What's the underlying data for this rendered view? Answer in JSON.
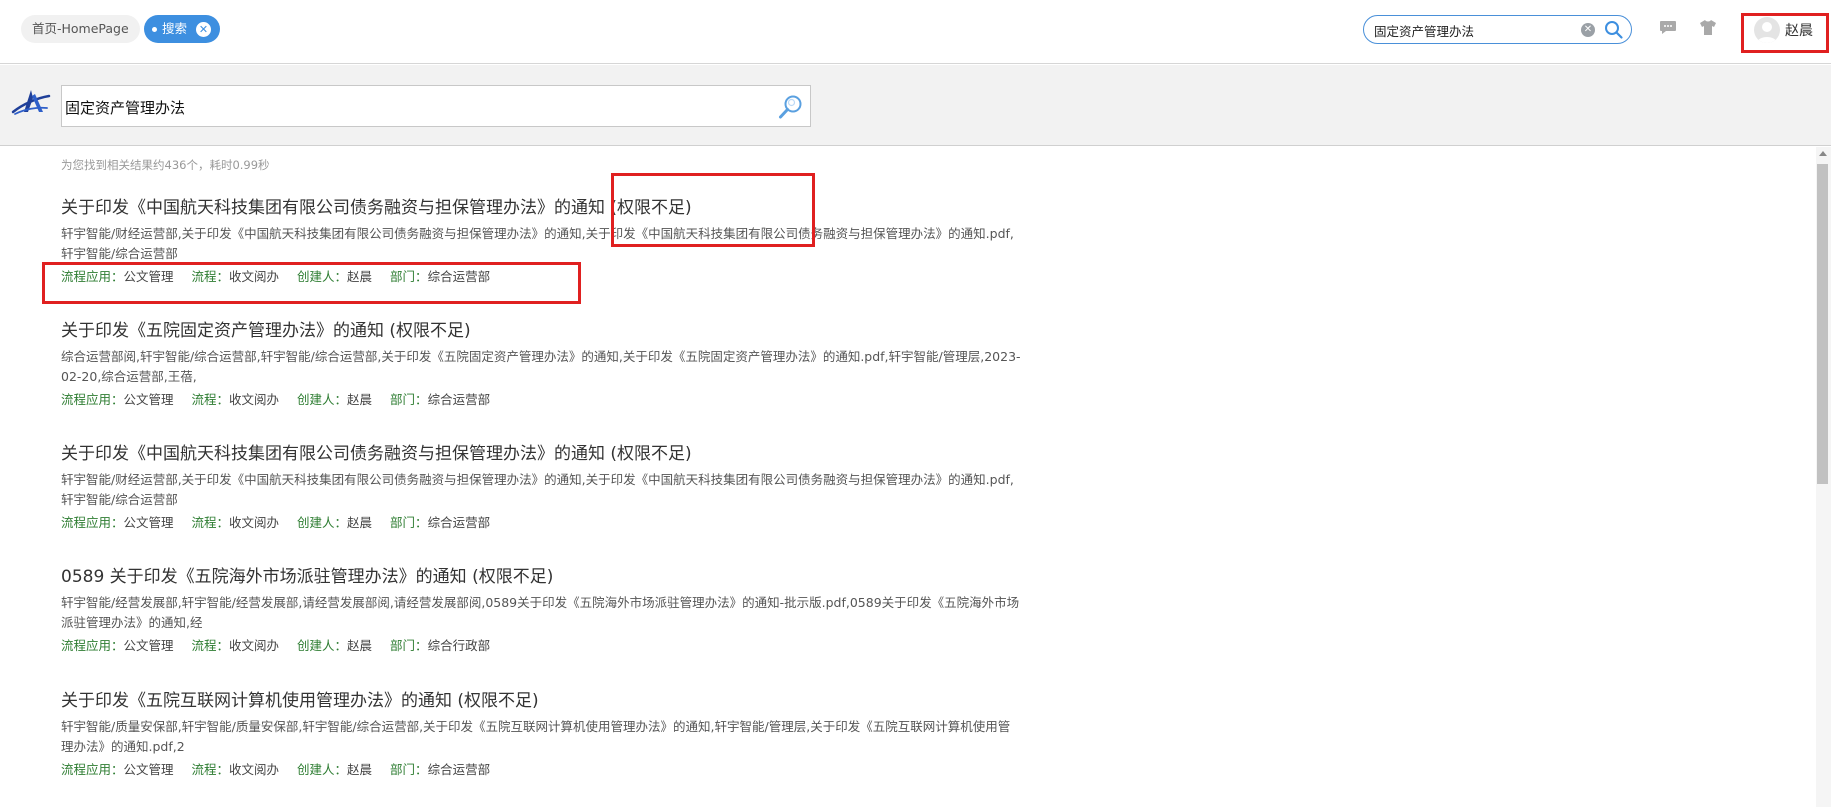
{
  "tabs": {
    "home_label": "首页-HomePage",
    "search_label": "搜索",
    "close_glyph": "✕"
  },
  "top_search": {
    "value": "固定资产管理办法",
    "clear_glyph": "✕"
  },
  "user": {
    "name": "赵晨"
  },
  "main_search": {
    "value": "固定资产管理办法"
  },
  "result_count": "为您找到相关结果约436个，耗时0.99秒",
  "meta_keys": {
    "app": "流程应用：",
    "flow": "流程：",
    "creator": "创建人：",
    "dept": "部门："
  },
  "results": [
    {
      "title": "关于印发《中国航天科技集团有限公司债务融资与担保管理办法》的通知 (权限不足)",
      "desc": "轩宇智能/财经运营部,关于印发《中国航天科技集团有限公司债务融资与担保管理办法》的通知,关于印发《中国航天科技集团有限公司债务融资与担保管理办法》的通知.pdf,轩宇智能/综合运营部",
      "app": "公文管理",
      "flow": "收文阅办",
      "creator": "赵晨",
      "dept": "综合运营部"
    },
    {
      "title": "关于印发《五院固定资产管理办法》的通知 (权限不足)",
      "desc": "综合运营部阅,轩宇智能/综合运营部,轩宇智能/综合运营部,关于印发《五院固定资产管理办法》的通知,关于印发《五院固定资产管理办法》的通知.pdf,轩宇智能/管理层,2023-02-20,综合运营部,王蓓,",
      "app": "公文管理",
      "flow": "收文阅办",
      "creator": "赵晨",
      "dept": "综合运营部"
    },
    {
      "title": "关于印发《中国航天科技集团有限公司债务融资与担保管理办法》的通知 (权限不足)",
      "desc": "轩宇智能/财经运营部,关于印发《中国航天科技集团有限公司债务融资与担保管理办法》的通知,关于印发《中国航天科技集团有限公司债务融资与担保管理办法》的通知.pdf,轩宇智能/综合运营部",
      "app": "公文管理",
      "flow": "收文阅办",
      "creator": "赵晨",
      "dept": "综合运营部"
    },
    {
      "title": "0589 关于印发《五院海外市场派驻管理办法》的通知 (权限不足)",
      "desc": "轩宇智能/经营发展部,轩宇智能/经营发展部,请经营发展部阅,请经营发展部阅,0589关于印发《五院海外市场派驻管理办法》的通知-批示版.pdf,0589关于印发《五院海外市场派驻管理办法》的通知,经",
      "app": "公文管理",
      "flow": "收文阅办",
      "creator": "赵晨",
      "dept": "综合行政部"
    },
    {
      "title": "关于印发《五院互联网计算机使用管理办法》的通知 (权限不足)",
      "desc": "轩宇智能/质量安保部,轩宇智能/质量安保部,轩宇智能/综合运营部,关于印发《五院互联网计算机使用管理办法》的通知,轩宇智能/管理层,关于印发《五院互联网计算机使用管理办法》的通知.pdf,2",
      "app": "公文管理",
      "flow": "收文阅办",
      "creator": "赵晨",
      "dept": "综合运营部"
    }
  ]
}
